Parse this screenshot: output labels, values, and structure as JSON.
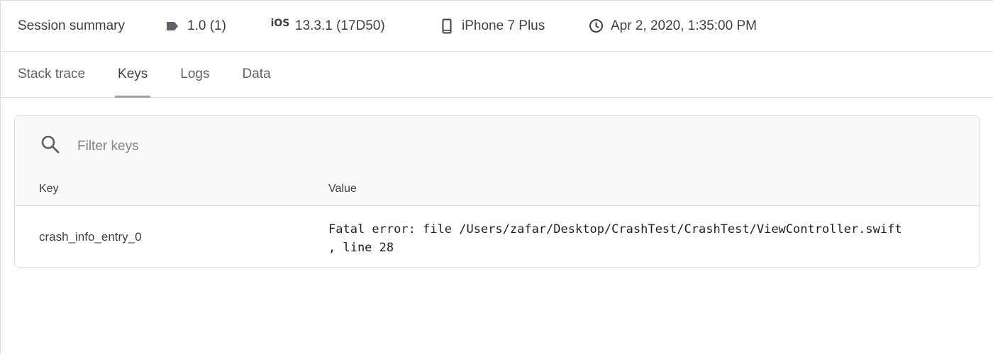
{
  "summary": {
    "title": "Session summary",
    "version": "1.0 (1)",
    "os": "13.3.1 (17D50)",
    "os_icon_text": "iOS",
    "device": "iPhone 7 Plus",
    "timestamp": "Apr 2, 2020, 1:35:00 PM",
    "icons": {
      "version": "tag-icon",
      "os": "ios-icon",
      "device": "phone-icon",
      "timestamp": "clock-icon"
    }
  },
  "tabs": [
    {
      "label": "Stack trace",
      "active": false
    },
    {
      "label": "Keys",
      "active": true
    },
    {
      "label": "Logs",
      "active": false
    },
    {
      "label": "Data",
      "active": false
    }
  ],
  "keys_panel": {
    "search": {
      "placeholder": "Filter keys",
      "value": ""
    },
    "columns": {
      "key": "Key",
      "value": "Value"
    },
    "rows": [
      {
        "key": "crash_info_entry_0",
        "value": "Fatal error: file /Users/zafar/Desktop/CrashTest/CrashTest/ViewController.swift\n, line 28"
      }
    ]
  },
  "colors": {
    "text_primary": "#3c4043",
    "text_secondary": "#5f6368",
    "border": "#dadce0",
    "card_header_bg": "#f8f9fa",
    "tab_indicator": "#9aa0a6"
  }
}
